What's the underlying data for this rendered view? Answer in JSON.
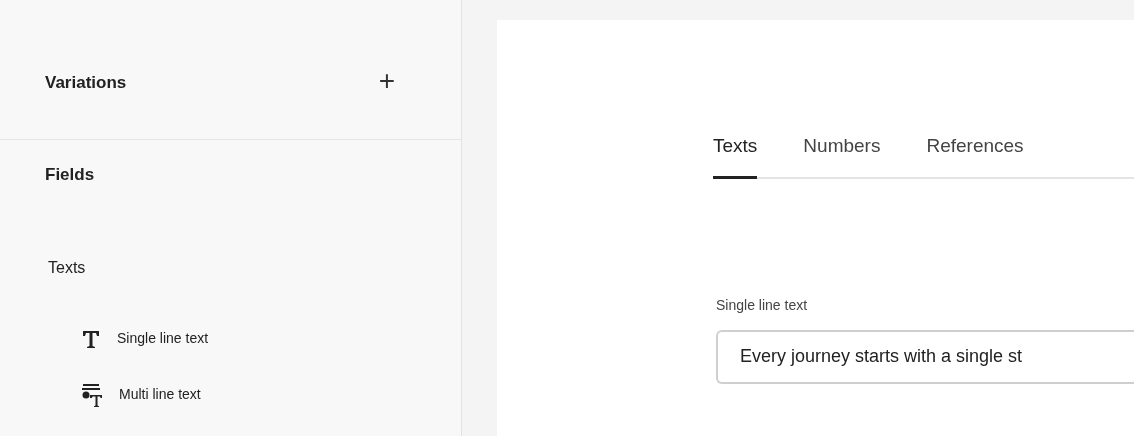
{
  "sidebar": {
    "variations": {
      "title": "Variations",
      "add_label": "+"
    },
    "fields": {
      "title": "Fields",
      "groups": [
        {
          "title": "Texts",
          "items": [
            {
              "kind": "single",
              "label": "Single line text"
            },
            {
              "kind": "multi",
              "label": "Multi line text"
            }
          ]
        }
      ]
    }
  },
  "main": {
    "tabs": [
      {
        "label": "Texts",
        "selected": true
      },
      {
        "label": "Numbers",
        "selected": false
      },
      {
        "label": "References",
        "selected": false
      }
    ],
    "field": {
      "label": "Single line text",
      "value": "Every journey starts with a single st"
    }
  }
}
